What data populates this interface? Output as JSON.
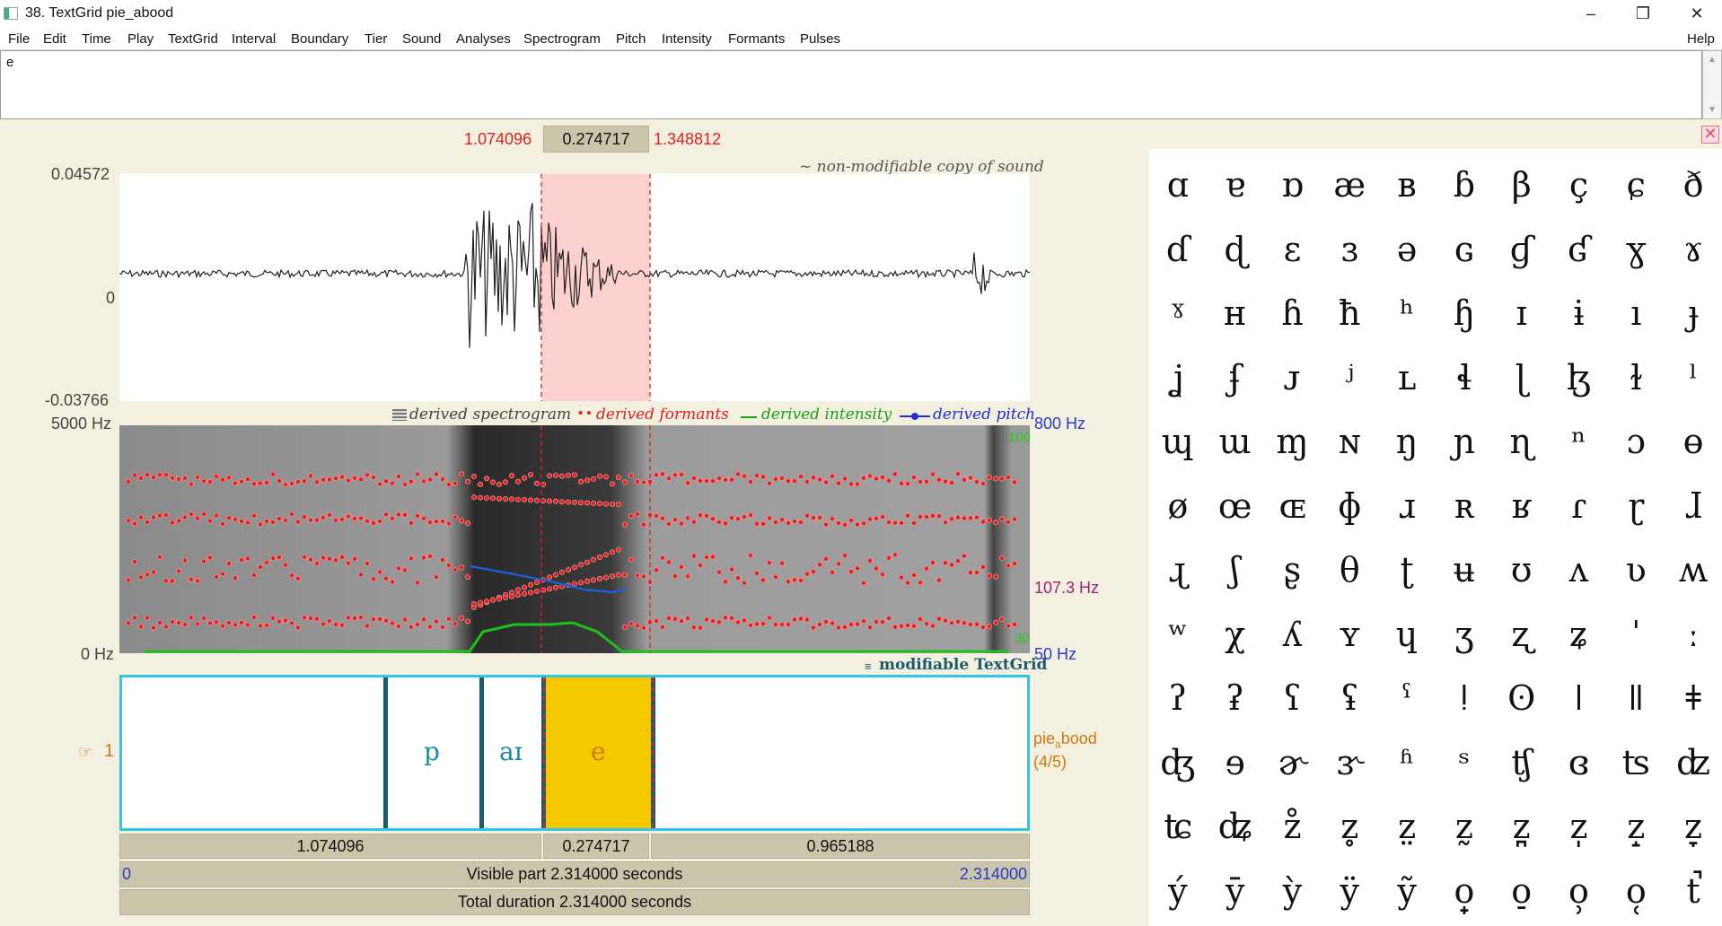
{
  "window": {
    "title": "38. TextGrid pie_abood",
    "minimize": "–",
    "maximize": "❐",
    "close": "✕"
  },
  "menu": [
    "File",
    "Edit",
    "Time",
    "Play",
    "TextGrid",
    "Interval",
    "Boundary",
    "Tier",
    "Sound",
    "Analyses",
    "Spectrogram",
    "Pitch",
    "Intensity",
    "Formants",
    "Pulses"
  ],
  "help": "Help",
  "text_field": {
    "value": "e"
  },
  "selection": {
    "start": "1.074096",
    "duration": "0.274717",
    "end": "1.348812"
  },
  "waveform": {
    "ymax": "0.04572",
    "yzero": "0",
    "ymin": "-0.03766",
    "note": "~ non-modifiable copy of sound"
  },
  "spectrogram": {
    "fmax": "5000 Hz",
    "fmin": "0 Hz",
    "pitch_top": "800 Hz",
    "pitch_cursor": "107.3 Hz",
    "pitch_bottom": "50 Hz",
    "intensity_top": "100 dB",
    "intensity_bottom": "30 dB",
    "legend": [
      "derived spectrogram",
      "derived formants",
      "derived intensity",
      "derived pitch"
    ]
  },
  "textgrid_note": "modifiable TextGrid",
  "tier": {
    "number": "1",
    "name": "pie",
    "name_sub": "a",
    "name_rest": "bood",
    "count": "(4/5)",
    "intervals": [
      "p",
      "aɪ",
      "e"
    ]
  },
  "durations": {
    "left": "1.074096",
    "selected": "0.274717",
    "right": "0.965188"
  },
  "visible": {
    "start": "0",
    "label": "Visible part 2.314000 seconds",
    "end": "2.314000"
  },
  "total": "Total duration 2.314000 seconds",
  "ipa_keys": [
    "ɑ",
    "ɐ",
    "ɒ",
    "æ",
    "ʙ",
    "ɓ",
    "β",
    "ç",
    "ɕ",
    "ð",
    "ɗ",
    "ɖ",
    "ɛ",
    "ɜ",
    "ə",
    "ɢ",
    "ɠ",
    "ʛ",
    "ɣ",
    "ɤ",
    "ˠ",
    "ʜ",
    "ɦ",
    "ħ",
    "ʰ",
    "ɧ",
    "ɪ",
    "ɨ",
    "ı",
    "ɟ",
    "ʝ",
    "ʄ",
    "ᴊ",
    "ʲ",
    "ʟ",
    "ɬ",
    "ɭ",
    "ɮ",
    "ɫ",
    "ˡ",
    "ɰ",
    "ɯ",
    "ɱ",
    "ɴ",
    "ŋ",
    "ɲ",
    "ɳ",
    "ⁿ",
    "ɔ",
    "ɵ",
    "ø",
    "œ",
    "ɶ",
    "ɸ",
    "ɹ",
    "ʀ",
    "ʁ",
    "ɾ",
    "ɽ",
    "ɺ",
    "ɻ",
    "ʃ",
    "ʂ",
    "θ",
    "ʈ",
    "ʉ",
    "ʊ",
    "ʌ",
    "ʋ",
    "ʍ",
    "ʷ",
    "χ",
    "ʎ",
    "ʏ",
    "ɥ",
    "ʒ",
    "ʐ",
    "ʑ",
    "ˈ",
    "ː",
    "ʔ",
    "ʡ",
    "ʕ",
    "ʢ",
    "ˤ",
    "ǃ",
    "ʘ",
    "ǀ",
    "ǁ",
    "ǂ",
    "ʤ",
    "ɘ",
    "ɚ",
    "ɝ",
    "ʱ",
    "ˢ",
    "ʧ",
    "ɞ",
    "ʦ",
    "ʣ",
    "ʨ",
    "ʥ",
    "z̊",
    "z̥",
    "z̤",
    "z̰",
    "z̪",
    "z̩",
    "z̝",
    "z̞",
    "ý",
    "ȳ",
    "ỳ",
    "ÿ",
    "ỹ",
    "o̟",
    "o̠",
    "o̹",
    "o̜",
    "t̚"
  ]
}
